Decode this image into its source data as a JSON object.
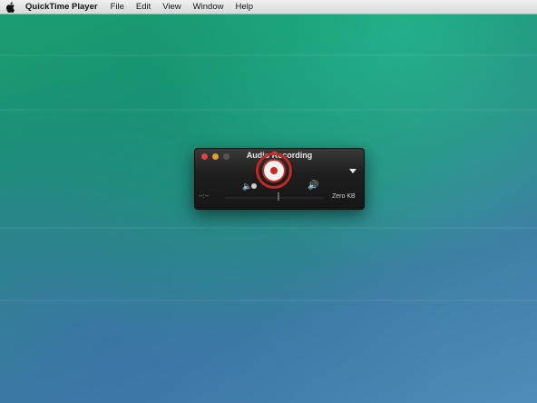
{
  "menubar": {
    "app_name": "QuickTime Player",
    "items": [
      "File",
      "Edit",
      "View",
      "Window",
      "Help"
    ]
  },
  "window": {
    "title": "Audio Recording",
    "elapsed_time": "--:--",
    "file_size": "Zero KB"
  },
  "icons": {
    "apple": "apple-logo-icon",
    "record": "record-icon",
    "volume_low": "speaker-low-icon",
    "volume_high": "speaker-high-icon",
    "dropdown": "dropdown-arrow-icon"
  },
  "colors": {
    "record_red": "#d0281f",
    "close_red": "#e0443e",
    "minimize_yellow": "#dea123"
  }
}
